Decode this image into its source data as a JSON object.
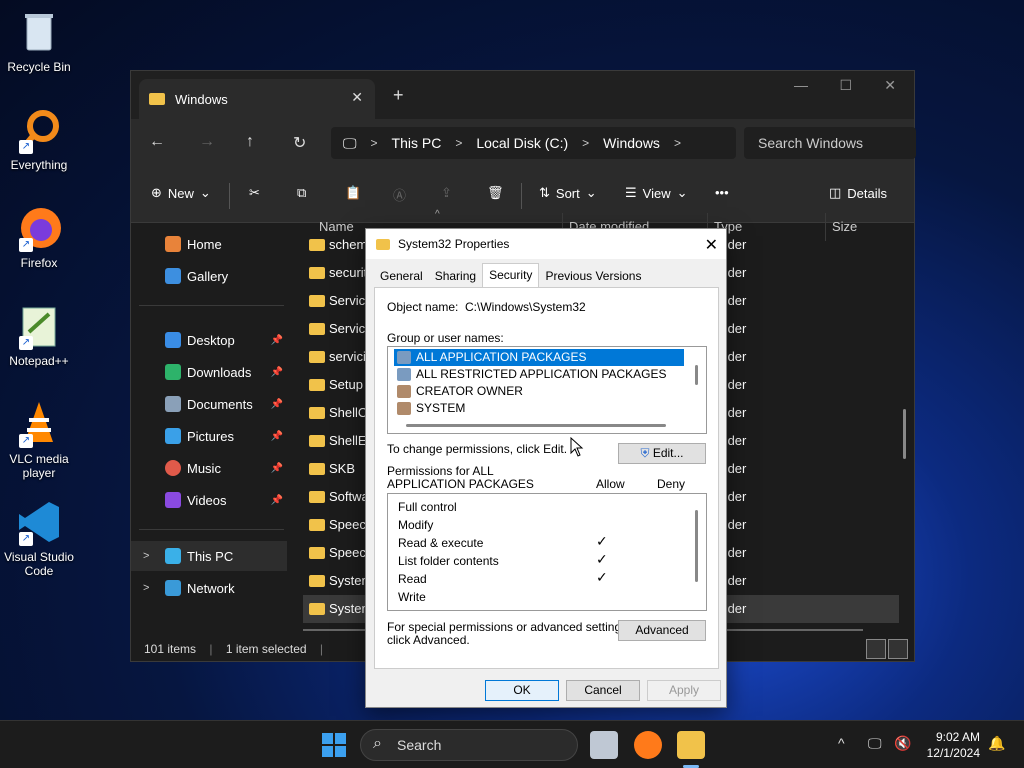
{
  "desktop": {
    "icons": [
      {
        "label": "Recycle Bin"
      },
      {
        "label": "Everything"
      },
      {
        "label": "Firefox"
      },
      {
        "label": "Notepad++"
      },
      {
        "label": "VLC media player"
      },
      {
        "label": "Visual Studio Code"
      }
    ]
  },
  "explorer": {
    "tab_title": "Windows",
    "breadcrumb": [
      "This PC",
      "Local Disk (C:)",
      "Windows"
    ],
    "search_placeholder": "Search Windows",
    "commands": {
      "new": "New",
      "sort": "Sort",
      "view": "View",
      "more": "•••",
      "details": "Details"
    },
    "nav": {
      "home": "Home",
      "gallery": "Gallery",
      "desktop": "Desktop",
      "downloads": "Downloads",
      "documents": "Documents",
      "pictures": "Pictures",
      "music": "Music",
      "videos": "Videos",
      "this_pc": "This PC",
      "network": "Network"
    },
    "columns": {
      "name": "Name",
      "date": "Date modified",
      "type": "Type",
      "size": "Size"
    },
    "rows": [
      {
        "name": "schema",
        "type": "e folder"
      },
      {
        "name": "security",
        "type": "e folder"
      },
      {
        "name": "Service",
        "type": "e folder"
      },
      {
        "name": "Service",
        "type": "e folder"
      },
      {
        "name": "servicin",
        "type": "e folder"
      },
      {
        "name": "Setup",
        "type": "e folder"
      },
      {
        "name": "ShellCo",
        "type": "e folder"
      },
      {
        "name": "ShellEx",
        "type": "e folder"
      },
      {
        "name": "SKB",
        "type": "e folder"
      },
      {
        "name": "Softwa",
        "type": "e folder"
      },
      {
        "name": "Speech",
        "type": "e folder"
      },
      {
        "name": "Speech",
        "type": "e folder"
      },
      {
        "name": "System",
        "type": "e folder"
      },
      {
        "name": "System",
        "type": "e folder"
      }
    ],
    "status": {
      "items": "101 items",
      "selected": "1 item selected"
    }
  },
  "dialog": {
    "title": "System32 Properties",
    "tabs": [
      "General",
      "Sharing",
      "Security",
      "Previous Versions"
    ],
    "object_name_label": "Object name:",
    "object_name_value": "C:\\Windows\\System32",
    "group_label": "Group or user names:",
    "users": [
      "ALL APPLICATION PACKAGES",
      "ALL RESTRICTED APPLICATION PACKAGES",
      "CREATOR OWNER",
      "SYSTEM"
    ],
    "change_text": "To change permissions, click Edit.",
    "edit_button": "Edit...",
    "permissions_for_line1": "Permissions for ALL",
    "permissions_for_line2": "APPLICATION PACKAGES",
    "allow_header": "Allow",
    "deny_header": "Deny",
    "permissions": [
      {
        "name": "Full control",
        "allow": ""
      },
      {
        "name": "Modify",
        "allow": ""
      },
      {
        "name": "Read & execute",
        "allow": "✓"
      },
      {
        "name": "List folder contents",
        "allow": "✓"
      },
      {
        "name": "Read",
        "allow": "✓"
      },
      {
        "name": "Write",
        "allow": ""
      }
    ],
    "special_line1": "For special permissions or advanced settings,",
    "special_line2": "click Advanced.",
    "advanced_button": "Advanced",
    "ok": "OK",
    "cancel": "Cancel",
    "apply": "Apply"
  },
  "taskbar": {
    "search": "Search",
    "time": "9:02 AM",
    "date": "12/1/2024"
  },
  "colors": {
    "accent": "#0078d7",
    "folder": "#f1c24a"
  }
}
